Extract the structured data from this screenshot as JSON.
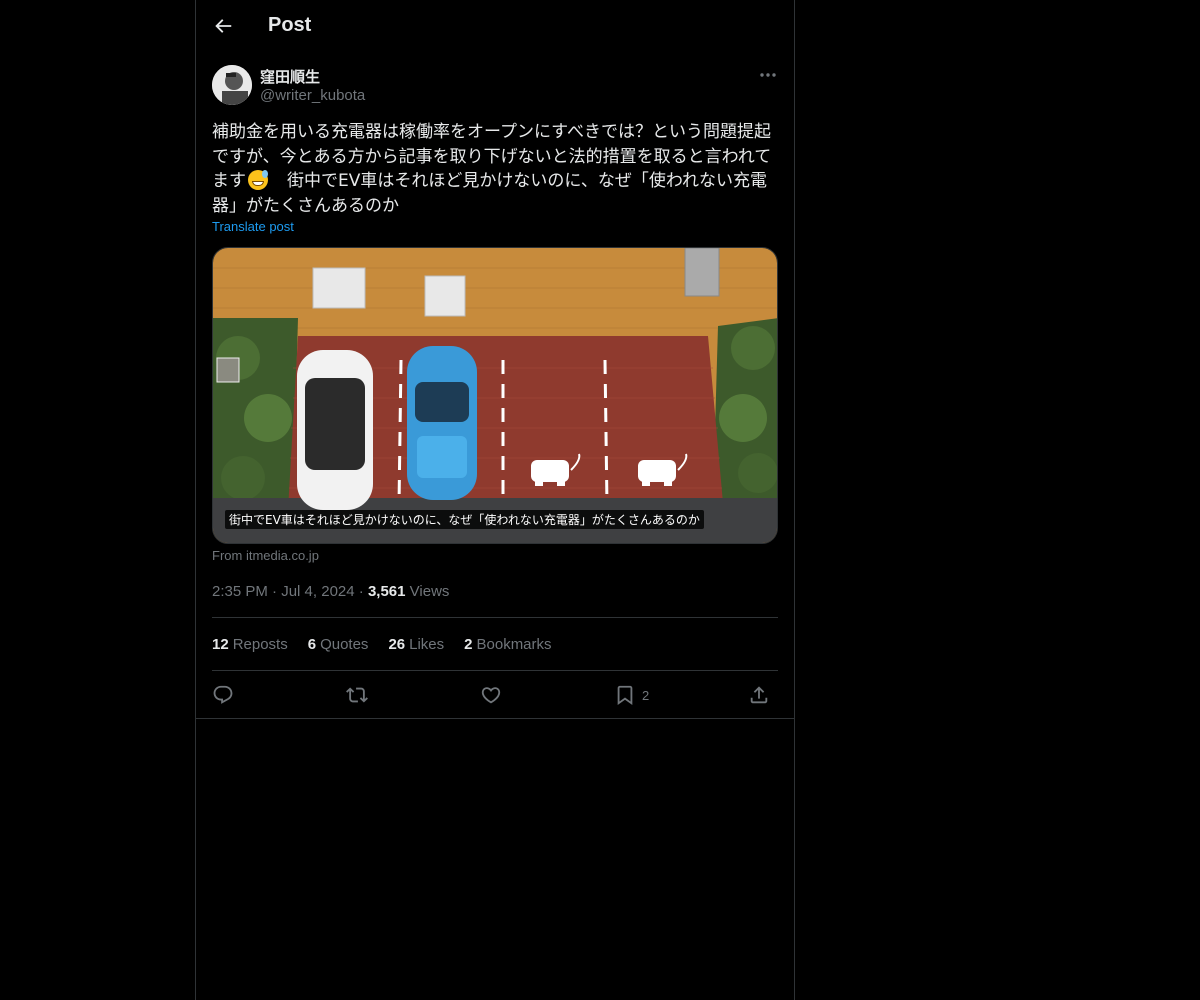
{
  "header": {
    "title": "Post",
    "back_icon": "arrow-left-icon"
  },
  "author": {
    "display_name": "窪田順生",
    "handle": "@writer_kubota",
    "more_icon": "more-horizontal-icon"
  },
  "post": {
    "text_before_emoji": "補助金を用いる充電器は稼働率をオープンにすべきでは？という問題提起ですが、今とある方から記事を取り下げないと法的措置を取ると言われてます",
    "emoji": "grinning-face-with-sweat",
    "text_after_emoji": "　街中でEV車はそれほど見かけないのに、なぜ「使われない充電器」がたくさんあるのか",
    "translate_label": "Translate post"
  },
  "media": {
    "caption": "街中でEV車はそれほど見かけないのに、なぜ「使われない充電器」がたくさんあるのか",
    "source": "From itmedia.co.jp"
  },
  "meta": {
    "time": "2:35 PM",
    "date": "Jul 4, 2024",
    "views_count": "3,561",
    "views_label": "Views"
  },
  "stats": {
    "reposts_count": "12",
    "reposts_label": "Reposts",
    "quotes_count": "6",
    "quotes_label": "Quotes",
    "likes_count": "26",
    "likes_label": "Likes",
    "bookmarks_count": "2",
    "bookmarks_label": "Bookmarks"
  },
  "actions": {
    "reply_icon": "reply-icon",
    "repost_icon": "repost-icon",
    "like_icon": "heart-icon",
    "bookmark_icon": "bookmark-icon",
    "bookmark_count": "2",
    "share_icon": "share-icon"
  },
  "colors": {
    "background": "#000000",
    "text": "#e7e9ea",
    "muted": "#71767b",
    "accent": "#1d9bf0",
    "border": "#2f3336"
  }
}
